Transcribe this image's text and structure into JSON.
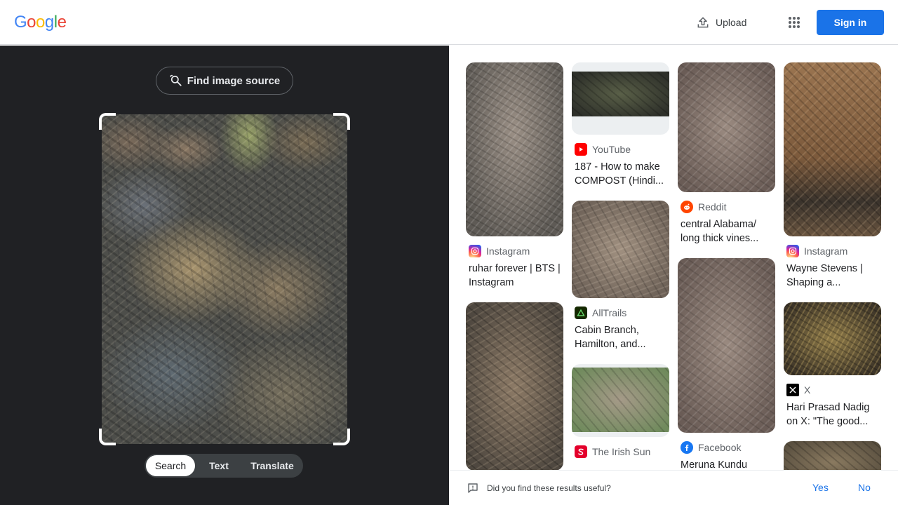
{
  "header": {
    "logo_letters": [
      "G",
      "o",
      "o",
      "g",
      "l",
      "e"
    ],
    "upload_label": "Upload",
    "apps_icon": "grid-apps-icon",
    "signin_label": "Sign in"
  },
  "lens": {
    "find_source_label": "Find image source",
    "modes": [
      {
        "label": "Search",
        "active": true
      },
      {
        "label": "Text",
        "active": false
      },
      {
        "label": "Translate",
        "active": false
      }
    ]
  },
  "results": {
    "col1": [
      {
        "source": "Instagram",
        "title": "ruhar forever | BTS | Instagram"
      },
      {
        "source": "",
        "title": ""
      }
    ],
    "col2": [
      {
        "source": "YouTube",
        "title": "187 - How to make COMPOST (Hindi..."
      },
      {
        "source": "AllTrails",
        "title": "Cabin Branch, Hamilton, and..."
      },
      {
        "source": "The Irish Sun",
        "title": ""
      }
    ],
    "col3": [
      {
        "source": "Reddit",
        "title": "central Alabama/ long thick vines..."
      },
      {
        "source": "Facebook",
        "title": "Meruna Kundu"
      }
    ],
    "col4": [
      {
        "source": "Instagram",
        "title": "Wayne Stevens | Shaping a..."
      },
      {
        "source": "X",
        "title": "Hari Prasad Nadig on X: \"The good..."
      },
      {
        "source": "",
        "title": ""
      }
    ]
  },
  "feedback": {
    "question": "Did you find these results useful?",
    "yes": "Yes",
    "no": "No"
  },
  "colors": {
    "accent": "#1a73e8",
    "left_panel_bg": "#202124",
    "youtube": "#ff0000",
    "reddit": "#ff4500",
    "facebook": "#1877f2",
    "alltrails": "#142800",
    "irish_sun": "#e4002b",
    "x": "#000000"
  }
}
